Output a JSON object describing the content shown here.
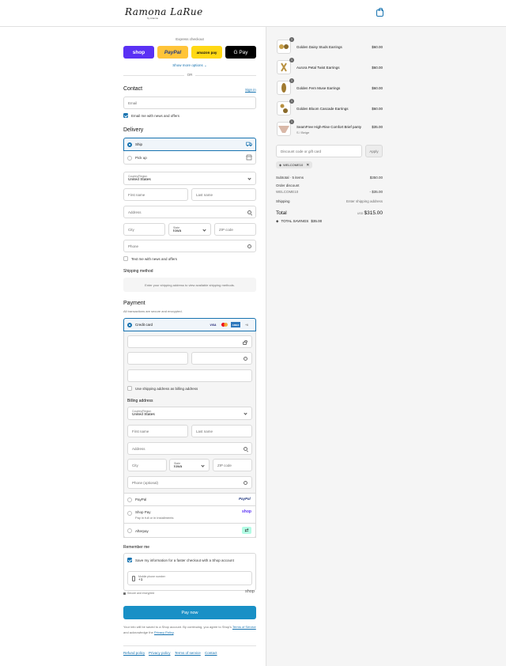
{
  "header": {
    "brand": "Ramona LaRue",
    "brand_sub": "by Arianne"
  },
  "express": {
    "label": "Express checkout",
    "shop": "shop",
    "paypal": "PayPal",
    "amazon": "amazon pay",
    "gpay": "G Pay",
    "more_options": "Show more options ⌄",
    "or": "OR"
  },
  "contact": {
    "title": "Contact",
    "sign_in": "Sign in",
    "email_placeholder": "Email",
    "news_label": "Email me with news and offers"
  },
  "delivery": {
    "title": "Delivery",
    "ship": "Ship",
    "pickup": "Pick up",
    "country_label": "Country/Region",
    "country": "United States",
    "first_name": "First name",
    "last_name": "Last name",
    "address": "Address",
    "city": "City",
    "state_label": "State",
    "state": "Iowa",
    "zip": "ZIP code",
    "phone": "Phone",
    "text_news": "Text me with news and offers"
  },
  "shipping_method": {
    "title": "Shipping method",
    "message": "Enter your shipping address to view available shipping methods."
  },
  "payment": {
    "title": "Payment",
    "subtitle": "All transactions are secure and encrypted.",
    "credit_card": "Credit card",
    "cards": [
      "VISA",
      "MC",
      "AMEX",
      "+6"
    ],
    "use_shipping": "Use shipping address as billing address",
    "billing_title": "Billing address",
    "billing": {
      "country_label": "Country/Region",
      "country": "United States",
      "first_name": "First name",
      "last_name": "Last name",
      "address": "Address",
      "city": "City",
      "state_label": "State",
      "state": "Iowa",
      "zip": "ZIP code",
      "phone": "Phone (optional)"
    },
    "paypal": "PayPal",
    "paypal_logo": "PayPal",
    "shoppay": "Shop Pay",
    "shoppay_sub": "Pay in full or in installments",
    "shoppay_logo": "shop",
    "afterpay": "Afterpay"
  },
  "remember": {
    "title": "Remember me",
    "save_label": "Save my information for a faster checkout with a Shop account",
    "mobile_label": "Mobile phone number",
    "mobile_value": "+1",
    "secure": "Secure and encrypted",
    "shop_logo": "shop"
  },
  "pay_now": "Pay now",
  "legal": {
    "text_1": "Your info will be saved to a Shop account. By continuing, you agree to Shop's",
    "tos": "Terms of Service",
    "text_2": "and acknowledge the",
    "privacy": "Privacy Policy",
    "period": "."
  },
  "footer": [
    "Refund policy",
    "Privacy policy",
    "Terms of service",
    "Contact"
  ],
  "order": {
    "items": [
      {
        "name": "Golden Daisy Studs Earrings",
        "price": "$60.00",
        "qty": "1",
        "variant": ""
      },
      {
        "name": "Aurora Petal Twist Earrings",
        "price": "$60.00",
        "qty": "1",
        "variant": ""
      },
      {
        "name": "Golden Fern Muse Earrings",
        "price": "$60.00",
        "qty": "1",
        "variant": ""
      },
      {
        "name": "Golden Bloom Cascade Earrings",
        "price": "$60.00",
        "qty": "1",
        "variant": ""
      },
      {
        "name": "SeamFree High-Rise Comfort Brief panty",
        "price": "$35.00",
        "qty": "1",
        "variant": "S / Beige"
      }
    ],
    "discount_placeholder": "Discount code or gift card",
    "apply": "Apply",
    "code": "WELCOME10",
    "subtotal_label": "Subtotal · 5 items",
    "subtotal": "$350.00",
    "order_discount_label": "Order discount",
    "discount_code": "WELCOME10",
    "discount_value": "- $35.00",
    "shipping_label": "Shipping",
    "shipping_value": "Enter shipping address",
    "total_label": "Total",
    "currency": "USD",
    "total": "$315.00",
    "savings_label": "TOTAL SAVINGS",
    "savings": "$35.00"
  },
  "colors": {
    "accent": "#1773b0",
    "shop_purple": "#5a31f4",
    "paypal_yellow": "#ffc439",
    "amazon_yellow": "#ffd814"
  }
}
